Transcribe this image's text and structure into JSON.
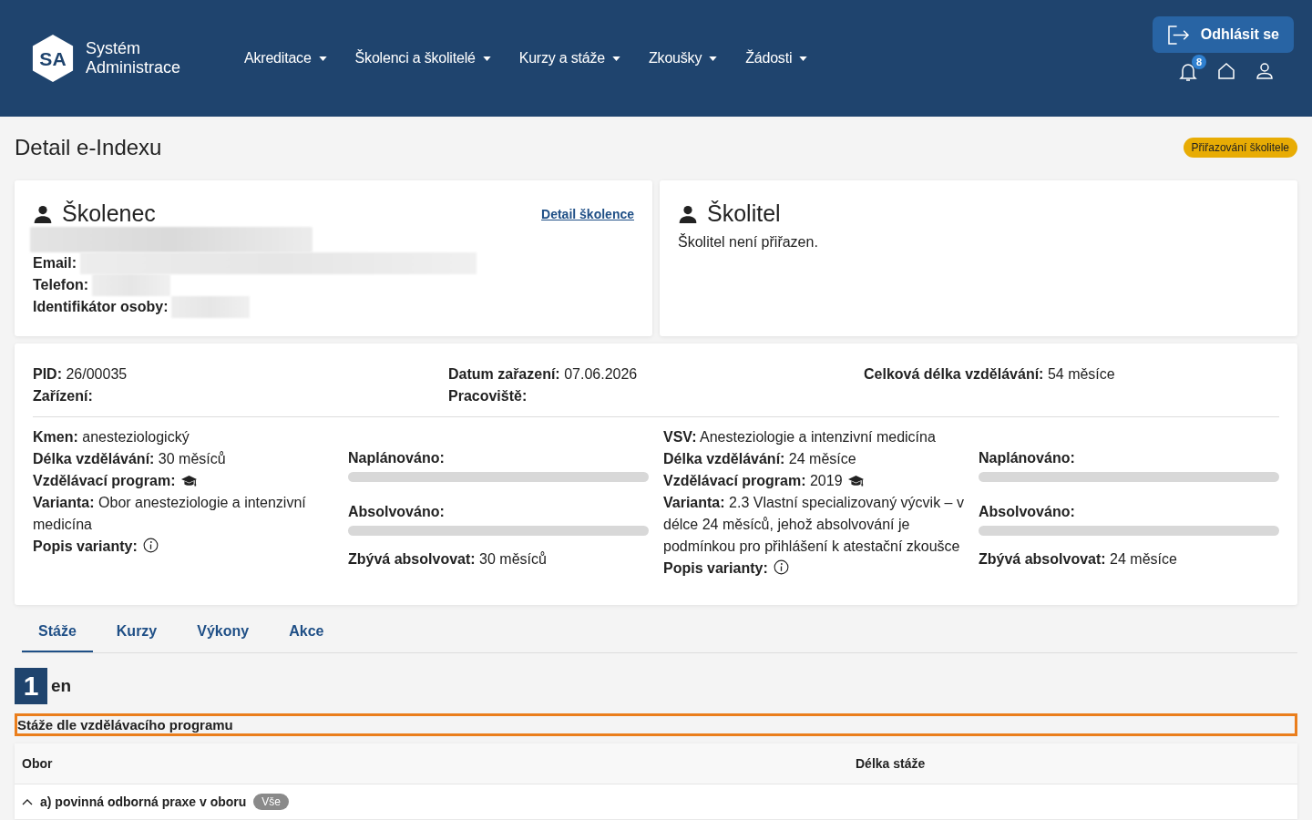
{
  "header": {
    "logo": {
      "mark": "SA",
      "line1": "Systém",
      "line2": "Administrace"
    },
    "nav": [
      {
        "label": "Akreditace"
      },
      {
        "label": "Školenci a školitelé"
      },
      {
        "label": "Kurzy a stáže"
      },
      {
        "label": "Zkoušky"
      },
      {
        "label": "Žádosti"
      }
    ],
    "logout": "Odhlásit se",
    "notifications_count": "8"
  },
  "page": {
    "title": "Detail e-Indexu",
    "status_badge": "Přiřazování školitele"
  },
  "trainee_card": {
    "title": "Školenec",
    "detail_link": "Detail školence",
    "fields": [
      {
        "label": "Email:"
      },
      {
        "label": "Telefon:"
      },
      {
        "label": "Identifikátor osoby:"
      }
    ]
  },
  "trainer_card": {
    "title": "Školitel",
    "note": "Školitel není přiřazen."
  },
  "summary": [
    [
      {
        "label": "PID:",
        "value": "26/00035"
      },
      {
        "label": "Zařízení:"
      }
    ],
    [
      {
        "label": "Datum zařazení:",
        "value": "07.06.2026"
      },
      {
        "label": "Pracoviště:"
      }
    ],
    [
      {
        "label": "Celková délka vzdělávání:",
        "value": "54 měsíce"
      }
    ]
  ],
  "blocks": [
    {
      "fields": [
        {
          "kind": "text",
          "label": "Kmen:",
          "value": "anesteziologický"
        },
        {
          "kind": "text",
          "label": "Délka vzdělávání:",
          "value": "30 měsíců"
        },
        {
          "kind": "program",
          "label": "Vzdělávací program:"
        },
        {
          "kind": "text",
          "label": "Varianta:",
          "value": "Obor anesteziologie a intenzivní medicína"
        },
        {
          "kind": "info",
          "label": "Popis varianty:"
        }
      ],
      "progress": [
        {
          "label": "Naplánováno:",
          "level": 0
        },
        {
          "label": "Absolvováno:",
          "level": 0
        }
      ],
      "remaining": {
        "label": "Zbývá absolvovat:",
        "value": "30 měsíců"
      }
    },
    {
      "fields": [
        {
          "kind": "text",
          "label": "VSV:",
          "value": "Anesteziologie a intenzivní medicína"
        },
        {
          "kind": "text",
          "label": "Délka vzdělávání:",
          "value": "24 měsíce"
        },
        {
          "kind": "program",
          "label": "Vzdělávací program:",
          "value": "2019"
        },
        {
          "kind": "text",
          "label": "Varianta:",
          "value": "2.3 Vlastní specializovaný výcvik – v délce 24 měsíců, jehož absolvování je podmínkou pro přihlášení k atestační zkoušce"
        },
        {
          "kind": "info",
          "label": "Popis varianty:"
        }
      ],
      "progress": [
        {
          "label": "Naplánováno:",
          "level": 0
        },
        {
          "label": "Absolvováno:",
          "level": 0
        }
      ],
      "remaining": {
        "label": "Zbývá absolvovat:",
        "value": "24 měsíce"
      }
    }
  ],
  "tabs": [
    {
      "label": "Stáže",
      "selected": true
    },
    {
      "label": "Kurzy",
      "selected": false
    },
    {
      "label": "Výkony",
      "selected": false
    },
    {
      "label": "Akce",
      "selected": false
    }
  ],
  "section": {
    "marker": "1",
    "heading": "en",
    "subheading": "Stáže dle vzdělávacího programu",
    "subheading_highlighted": true
  },
  "table": {
    "columns": [
      "Obor",
      "Délka stáže"
    ],
    "groups": [
      {
        "label": "a) povinná odborná praxe v oboru",
        "badge": "Vše",
        "expanded": true
      }
    ]
  }
}
